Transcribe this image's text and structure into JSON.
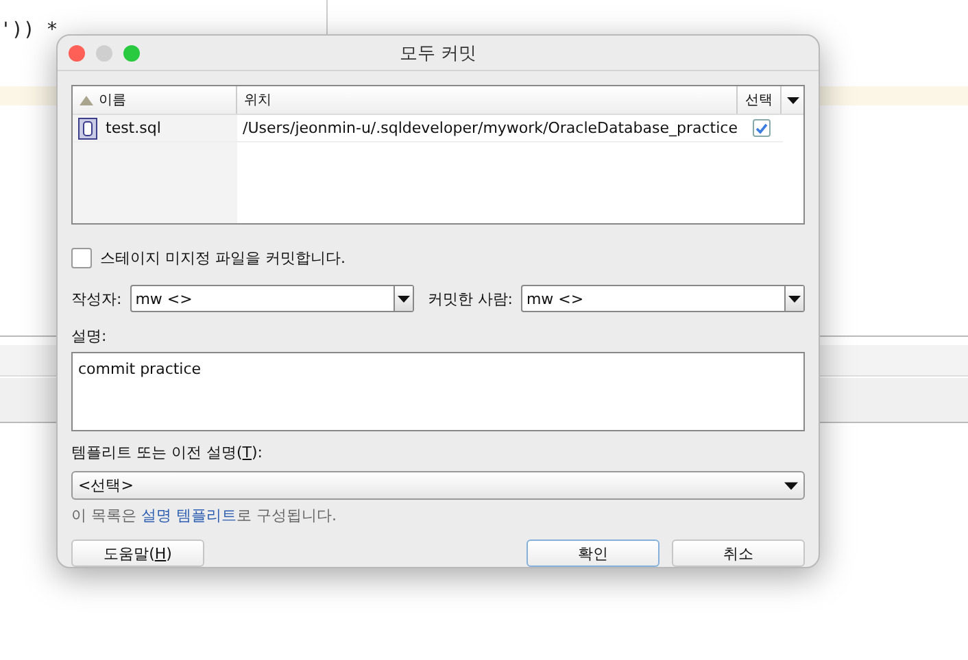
{
  "background": {
    "code_line": "')) *"
  },
  "window": {
    "title": "모두 커밋"
  },
  "table": {
    "columns": [
      {
        "label": "이름",
        "sorted": true
      },
      {
        "label": "위치"
      },
      {
        "label": "선택"
      }
    ],
    "rows": [
      {
        "name": "test.sql",
        "location": "/Users/jeonmin-u/.sqldeveloper/mywork/OracleDatabase_practice",
        "checked": true
      }
    ]
  },
  "stage_unstaged": {
    "label": "스테이지 미지정 파일을 커밋합니다.",
    "checked": false
  },
  "author": {
    "label": "작성자:",
    "value": "mw <>"
  },
  "committer": {
    "label": "커밋한 사람:",
    "value": "mw <>"
  },
  "description": {
    "label": "설명:",
    "value": "commit practice"
  },
  "template": {
    "label_before": "템플리트 또는 이전 설명(",
    "mnemonic": "T",
    "label_after": "):",
    "value": "<선택>"
  },
  "hint": {
    "before": "이 목록은 ",
    "link": "설명 템플리트",
    "after": "로 구성됩니다."
  },
  "buttons": [
    {
      "before": "도움말(",
      "mnemonic": "H",
      "after": ")",
      "kind": "help"
    },
    {
      "before": "확인",
      "kind": "default"
    },
    {
      "before": "취소",
      "kind": "plain"
    }
  ]
}
